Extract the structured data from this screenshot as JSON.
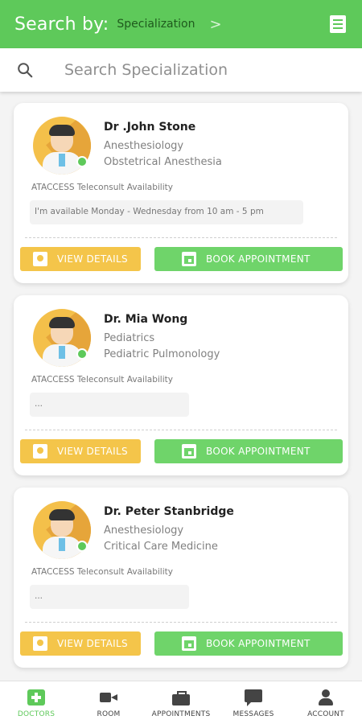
{
  "header": {
    "search_by_label": "Search by:",
    "selected_filter": "Specialization",
    "chevron": ">"
  },
  "search": {
    "placeholder": "Search Specialization"
  },
  "doctors": [
    {
      "name": "Dr .John Stone",
      "specialty": "Anesthesiology",
      "subspecialty": "Obstetrical Anesthesia",
      "availability_label": "ATACCESS Teleconsult Availability",
      "availability": "I'm available Monday - Wednesday from 10 am - 5 pm",
      "view_label": "VIEW DETAILS",
      "book_label": "BOOK APPOINTMENT"
    },
    {
      "name": "Dr. Mia Wong",
      "specialty": "Pediatrics",
      "subspecialty": "Pediatric Pulmonology",
      "availability_label": "ATACCESS Teleconsult Availability",
      "availability": "...",
      "view_label": "VIEW DETAILS",
      "book_label": "BOOK APPOINTMENT"
    },
    {
      "name": "Dr. Peter Stanbridge",
      "specialty": "Anesthesiology",
      "subspecialty": "Critical Care Medicine",
      "availability_label": "ATACCESS Teleconsult Availability",
      "availability": "...",
      "view_label": "VIEW DETAILS",
      "book_label": "BOOK APPOINTMENT"
    }
  ],
  "bottom_nav": [
    {
      "label": "DOCTORS",
      "icon": "medical-cross-icon",
      "active": true
    },
    {
      "label": "ROOM",
      "icon": "video-camera-icon",
      "active": false
    },
    {
      "label": "APPOINTMENTS",
      "icon": "briefcase-icon",
      "active": false
    },
    {
      "label": "MESSAGES",
      "icon": "chat-bubble-icon",
      "active": false
    },
    {
      "label": "ACCOUNT",
      "icon": "person-icon",
      "active": false
    }
  ],
  "colors": {
    "brand_green": "#5ec95a",
    "view_button": "#f4c54a",
    "book_button": "#6fd46a"
  }
}
